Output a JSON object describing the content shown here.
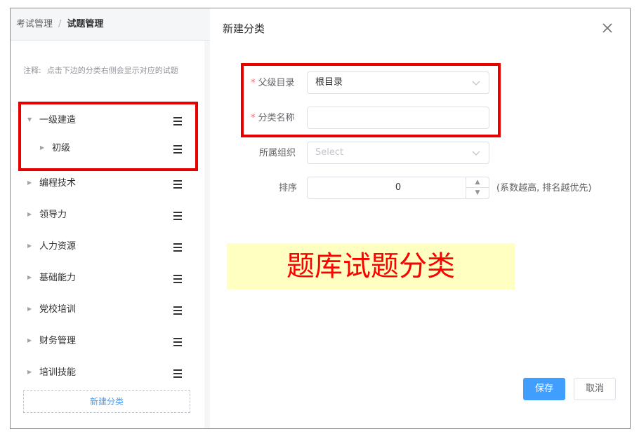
{
  "breadcrumb": {
    "parent": "考试管理",
    "separator": "/",
    "current": "试题管理"
  },
  "note": {
    "label": "注释:",
    "text": "点击下边的分类右侧会显示对应的试题"
  },
  "tree": {
    "items": [
      {
        "label": "一级建造",
        "expanded": true,
        "level": 0
      },
      {
        "label": "初级",
        "expanded": false,
        "level": 1
      },
      {
        "label": "编程技术",
        "expanded": false,
        "level": 0
      },
      {
        "label": "领导力",
        "expanded": false,
        "level": 0
      },
      {
        "label": "人力资源",
        "expanded": false,
        "level": 0
      },
      {
        "label": "基础能力",
        "expanded": false,
        "level": 0
      },
      {
        "label": "党校培训",
        "expanded": false,
        "level": 0
      },
      {
        "label": "财务管理",
        "expanded": false,
        "level": 0
      },
      {
        "label": "培训技能",
        "expanded": false,
        "level": 0
      }
    ],
    "add_button": "新建分类"
  },
  "dialog": {
    "title": "新建分类",
    "form": {
      "parent": {
        "label": "父级目录",
        "value": "根目录",
        "required": true
      },
      "name": {
        "label": "分类名称",
        "value": "",
        "required": true
      },
      "org": {
        "label": "所属组织",
        "placeholder": "Select"
      },
      "sort": {
        "label": "排序",
        "value": "0",
        "hint": "(系数越高, 排名越优先)"
      }
    },
    "save_button": "保存",
    "cancel_button": "取消"
  },
  "banner": {
    "text": "题库试题分类"
  },
  "colors": {
    "primary": "#409eff",
    "highlight_border": "#e60000",
    "banner_bg": "#ffffc2",
    "banner_text": "#ff0000",
    "required": "#f56c6c"
  }
}
